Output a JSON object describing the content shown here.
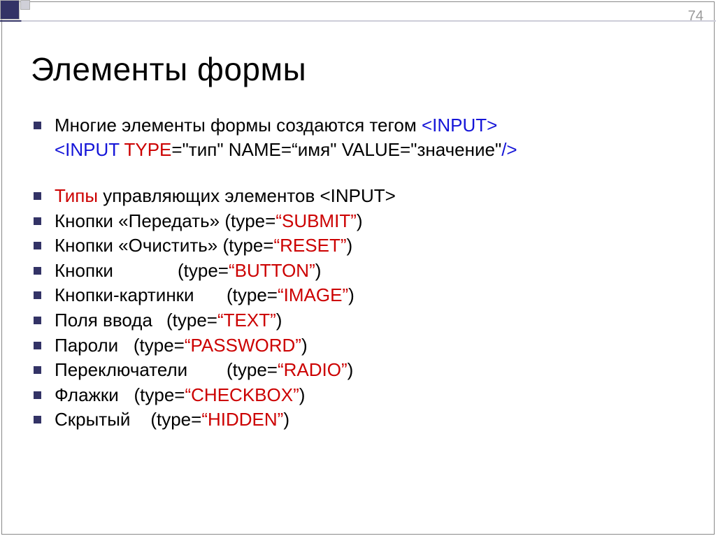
{
  "pageNumber": "74",
  "title": "Элементы формы",
  "intro": {
    "prefix": "Многие элементы формы создаются тегом ",
    "tag": "<INPUT>",
    "syntax_open": "<INPUT ",
    "attr_type": "TYPE",
    "attr_type_eq": "=\"тип\"  ",
    "attr_name": "NAME",
    "attr_name_eq": "=“имя\" ",
    "attr_value": "VALUE",
    "attr_value_eq": "=\"значение\"",
    "syntax_close": "/>"
  },
  "subhead": {
    "label": "Типы",
    "rest": " управляющих элементов <INPUT>"
  },
  "items": [
    {
      "label": "Кнопки «Передать» (type=",
      "value": "“SUBMIT”",
      "close": ")",
      "tab": ""
    },
    {
      "label": "Кнопки «Очистить» (type=",
      "value": "“RESET”",
      "close": ")",
      "tab": ""
    },
    {
      "label": "Кнопки",
      "value": "“BUTTON”",
      "close": ")",
      "tab": "tab1",
      "mid": "(type="
    },
    {
      "label": "Кнопки-картинки",
      "value": "“IMAGE”",
      "close": ")",
      "tab": "tab2",
      "mid": "(type="
    },
    {
      "label": "Поля ввода",
      "value": "“TEXT”",
      "close": ")",
      "tab": "tab3",
      "mid": "(type="
    },
    {
      "label": "Пароли",
      "value": "“PASSWORD”",
      "close": ")",
      "tab": "",
      "mid": "   (type="
    },
    {
      "label": "Переключатели",
      "value": "“RADIO”",
      "close": ")",
      "tab": "tab2",
      "mid": "(type="
    },
    {
      "label": "Флажки",
      "value": "“CHECKBOX”",
      "close": ")",
      "tab": "",
      "mid": "   (type="
    },
    {
      "label": "Скрытый",
      "value": "“HIDDEN”",
      "close": ")",
      "tab": "",
      "mid": "    (type="
    }
  ]
}
